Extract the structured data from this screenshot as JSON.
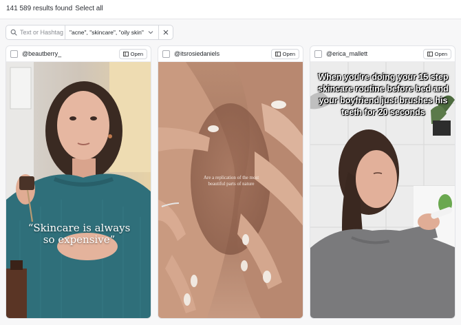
{
  "header": {
    "results_text": "141 589 results found",
    "select_all_label": "Select all"
  },
  "filters": {
    "search_placeholder": "Text or Hashtag",
    "search_value": "",
    "tags_value": "\"acne\", \"skincare\", \"oily skin\""
  },
  "cards": [
    {
      "handle": "@beautberry_",
      "open_label": "Open",
      "caption": "“Skincare is always so expensive”"
    },
    {
      "handle": "@itsrosiedaniels",
      "open_label": "Open",
      "caption": "Are a replication of the most beautiful parts of nature"
    },
    {
      "handle": "@erica_mallett",
      "open_label": "Open",
      "caption": "When you're doing your 15 step skincare routine before bed and your boyfriend just brushes his teeth for 20 seconds"
    }
  ],
  "colors": {
    "page_bg": "#f7f7f8",
    "border": "#d6d8dd",
    "sweater": "#2f6f7a",
    "skin": "#e3b29b",
    "bathroom_wall": "#ececec"
  }
}
